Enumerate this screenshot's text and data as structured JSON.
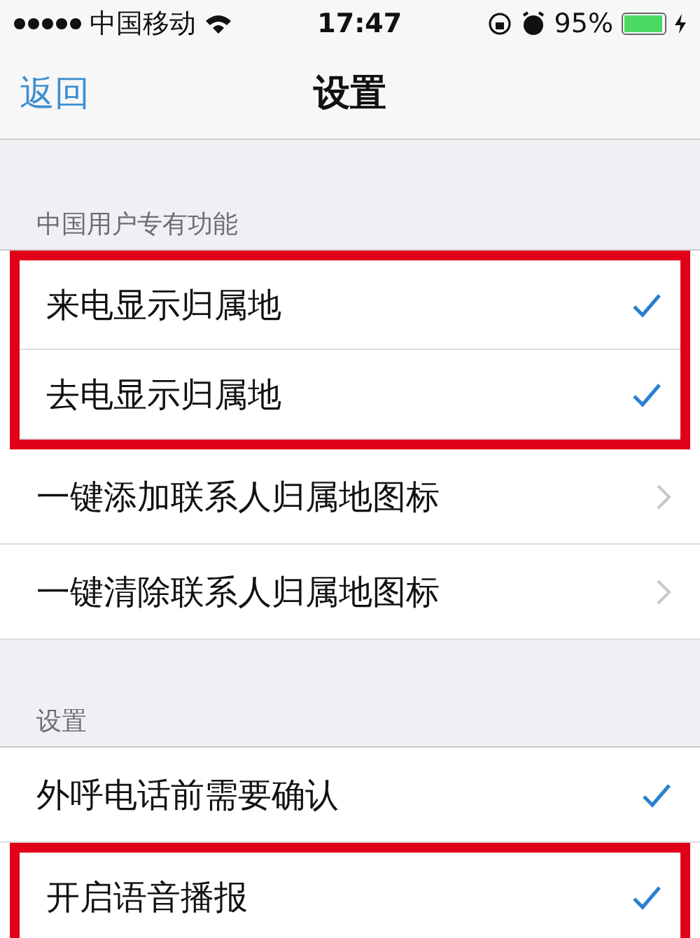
{
  "status_bar": {
    "carrier": "中国移动",
    "time": "17:47",
    "battery": "95%"
  },
  "nav": {
    "back": "返回",
    "title": "设置"
  },
  "sections": [
    {
      "header": "中国用户专有功能",
      "rows": [
        {
          "label": "来电显示归属地",
          "kind": "check",
          "checked": true,
          "highlighted": true
        },
        {
          "label": "去电显示归属地",
          "kind": "check",
          "checked": true,
          "highlighted": true
        },
        {
          "label": "一键添加联系人归属地图标",
          "kind": "link",
          "highlighted": false
        },
        {
          "label": "一键清除联系人归属地图标",
          "kind": "link",
          "highlighted": false
        }
      ]
    },
    {
      "header": "设置",
      "rows": [
        {
          "label": "外呼电话前需要确认",
          "kind": "check",
          "checked": true,
          "highlighted": false
        },
        {
          "label": "开启语音播报",
          "kind": "check",
          "checked": true,
          "highlighted": true
        }
      ]
    }
  ]
}
